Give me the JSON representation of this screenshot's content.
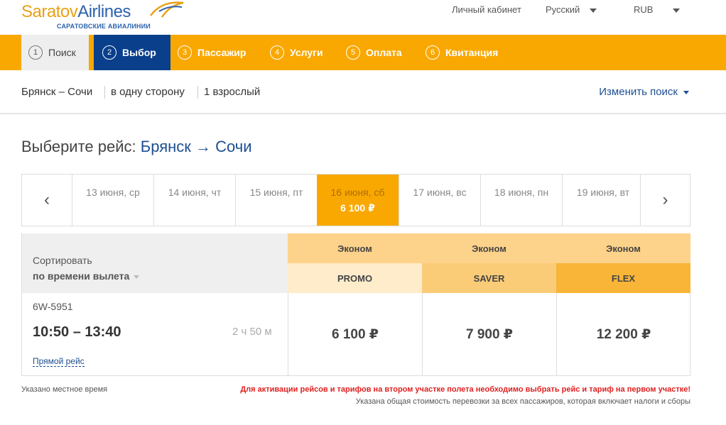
{
  "brand": {
    "logo_word1": "Saratov",
    "logo_word2": "Airlines",
    "logo_subtitle": "САРАТОВСКИЕ АВИАЛИНИИ",
    "color_orange": "#f9a802",
    "color_blue": "#0a3f8c"
  },
  "topnav": {
    "account": "Личный кабинет",
    "language": "Русский",
    "currency": "RUB"
  },
  "steps": [
    {
      "num": "1",
      "label": "Поиск",
      "state": "done"
    },
    {
      "num": "2",
      "label": "Выбор",
      "state": "active"
    },
    {
      "num": "3",
      "label": "Пассажир",
      "state": "pending"
    },
    {
      "num": "4",
      "label": "Услуги",
      "state": "pending"
    },
    {
      "num": "5",
      "label": "Оплата",
      "state": "pending"
    },
    {
      "num": "6",
      "label": "Квитанция",
      "state": "pending"
    }
  ],
  "summary": {
    "route": "Брянск – Сочи",
    "trip_type": "в одну сторону",
    "passengers": "1 взрослый",
    "change_search": "Изменить поиск"
  },
  "title": {
    "prefix": "Выберите рейс:",
    "from": "Брянск",
    "arrow": "→",
    "to": "Сочи"
  },
  "dates": [
    {
      "label": "13 июня, ср",
      "price": ""
    },
    {
      "label": "14 июня, чт",
      "price": ""
    },
    {
      "label": "15 июня, пт",
      "price": ""
    },
    {
      "label": "16 июня, сб",
      "price": "6 100 ₽",
      "selected": true
    },
    {
      "label": "17 июня, вс",
      "price": ""
    },
    {
      "label": "18 июня, пн",
      "price": ""
    },
    {
      "label": "19 июня, вт",
      "price": ""
    }
  ],
  "table": {
    "sort_label": "Сортировать",
    "sort_value": "по времени вылета",
    "classes": [
      "Эконом",
      "Эконом",
      "Эконом"
    ],
    "fares": [
      "PROMO",
      "SAVER",
      "FLEX"
    ]
  },
  "flight": {
    "number": "6W-5951",
    "times": "10:50 – 13:40",
    "duration": "2 ч 50 м",
    "direct": "Прямой рейс",
    "prices": [
      "6 100 ₽",
      "7 900 ₽",
      "12 200 ₽"
    ]
  },
  "notes": {
    "local_time": "Указано местное время",
    "warning": "Для активации рейсов и тарифов на втором участке полета необходимо выбрать рейс и тариф на первом участке!",
    "total": "Указана общая стоимость перевозки за всех пассажиров, которая включает налоги и сборы"
  }
}
